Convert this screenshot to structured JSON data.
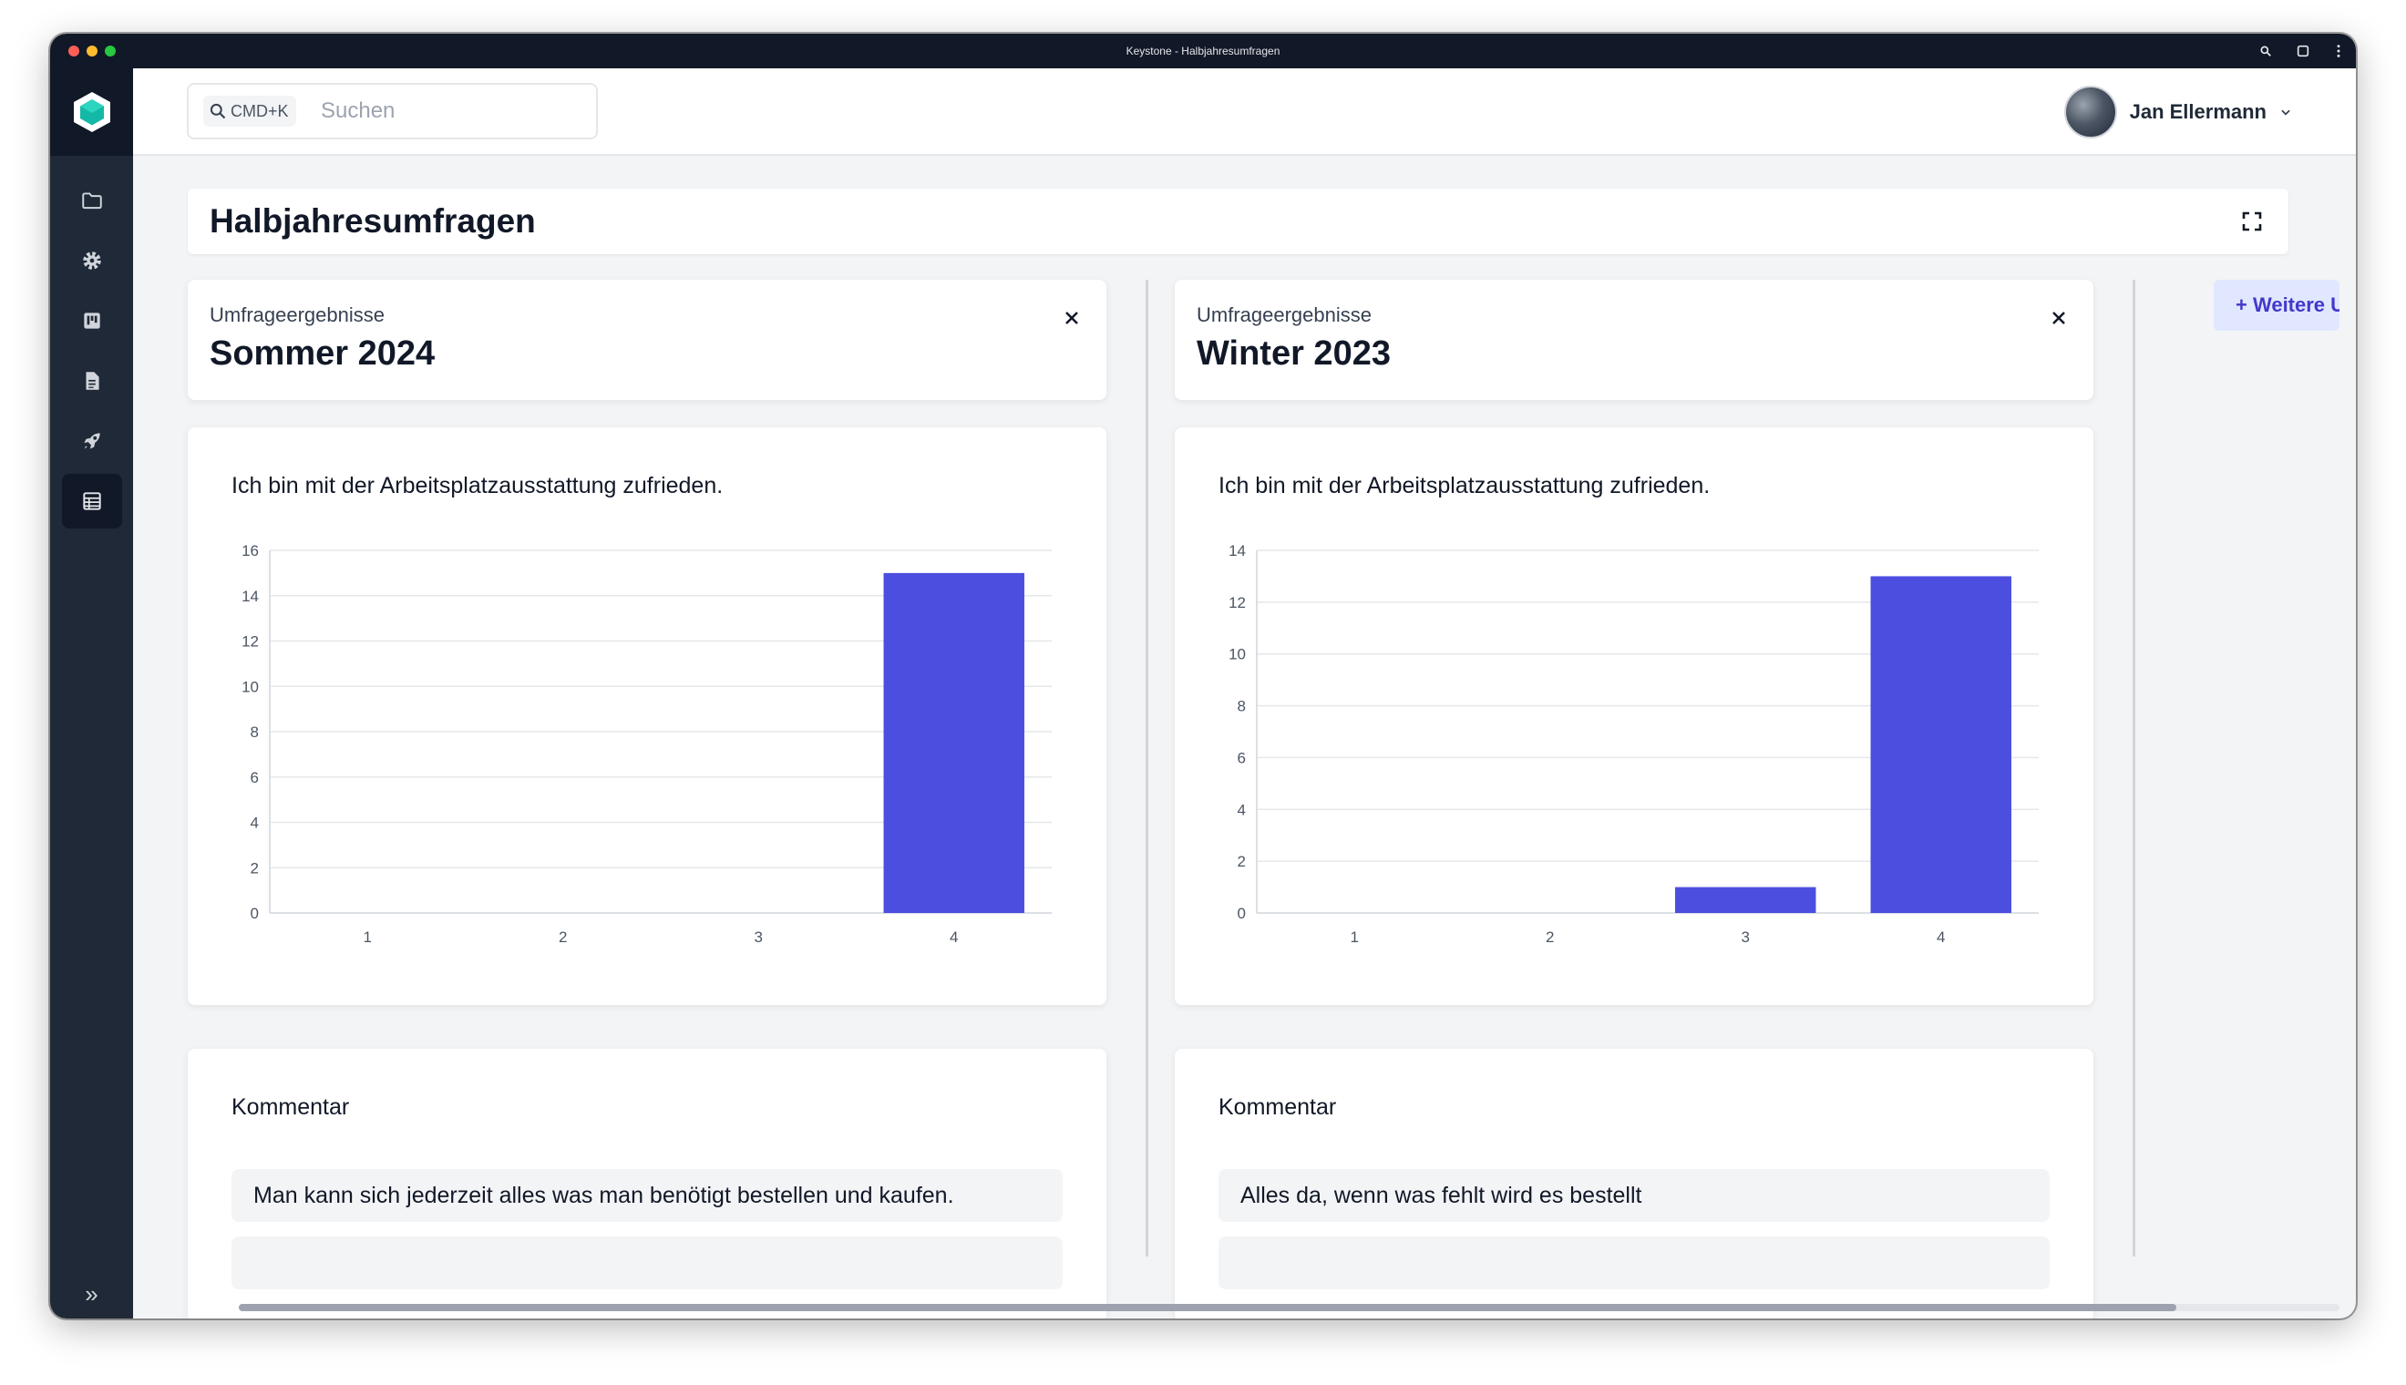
{
  "window": {
    "title": "Keystone - Halbjahresumfragen"
  },
  "header": {
    "search": {
      "shortcut": "CMD+K",
      "placeholder": "Suchen"
    },
    "user": {
      "name": "Jan Ellermann"
    }
  },
  "sidebar": {
    "items": [
      {
        "icon": "folder-icon"
      },
      {
        "icon": "gear-icon"
      },
      {
        "icon": "board-icon"
      },
      {
        "icon": "document-icon"
      },
      {
        "icon": "rocket-icon"
      },
      {
        "icon": "table-list-icon",
        "active": true
      }
    ],
    "expand_icon": "»"
  },
  "page": {
    "title": "Halbjahresumfragen"
  },
  "surveys": [
    {
      "label": "Umfrageergebnisse",
      "title": "Sommer 2024",
      "question": "Ich bin mit der Arbeitsplatzausstattung zufrieden.",
      "comment_title": "Kommentar",
      "comments": [
        "Man kann sich jederzeit alles was man benötigt bestellen und kaufen."
      ]
    },
    {
      "label": "Umfrageergebnisse",
      "title": "Winter 2023",
      "question": "Ich bin mit der Arbeitsplatzausstattung zufrieden.",
      "comment_title": "Kommentar",
      "comments": [
        "Alles da, wenn was fehlt wird es bestellt"
      ]
    }
  ],
  "add_button": {
    "label": "+ Weitere U"
  },
  "colors": {
    "bar": "#4c4ee0",
    "sidebar": "#1f2937",
    "accent_bg": "#e0e7ff",
    "accent_text": "#4338ca"
  },
  "chart_data": [
    {
      "type": "bar",
      "title": "Ich bin mit der Arbeitsplatzausstattung zufrieden.",
      "categories": [
        "1",
        "2",
        "3",
        "4"
      ],
      "values": [
        0,
        0,
        0,
        15
      ],
      "ylim": [
        0,
        16
      ],
      "yticks": [
        0,
        2,
        4,
        6,
        8,
        10,
        12,
        14,
        16
      ],
      "grid": true
    },
    {
      "type": "bar",
      "title": "Ich bin mit der Arbeitsplatzausstattung zufrieden.",
      "categories": [
        "1",
        "2",
        "3",
        "4"
      ],
      "values": [
        0,
        0,
        1,
        13
      ],
      "ylim": [
        0,
        14
      ],
      "yticks": [
        0,
        2,
        4,
        6,
        8,
        10,
        12,
        14
      ],
      "grid": true
    }
  ]
}
